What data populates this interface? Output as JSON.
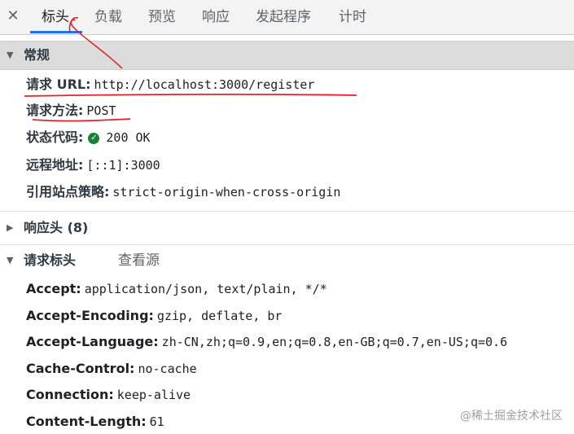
{
  "tabs": [
    "标头",
    "负载",
    "预览",
    "响应",
    "发起程序",
    "计时"
  ],
  "general": {
    "title": "常规",
    "rows": [
      {
        "key": "请求 URL:",
        "val": "http://localhost:3000/register"
      },
      {
        "key": "请求方法:",
        "val": "POST"
      },
      {
        "key": "状态代码:",
        "val": "200 OK"
      },
      {
        "key": "远程地址:",
        "val": "[::1]:3000"
      },
      {
        "key": "引用站点策略:",
        "val": "strict-origin-when-cross-origin"
      }
    ]
  },
  "response_headers": {
    "title": "响应头 (8)"
  },
  "request_headers": {
    "title": "请求标头",
    "view_source": "查看源",
    "rows": [
      {
        "key": "Accept:",
        "val": "application/json, text/plain, */*"
      },
      {
        "key": "Accept-Encoding:",
        "val": "gzip, deflate, br"
      },
      {
        "key": "Accept-Language:",
        "val": "zh-CN,zh;q=0.9,en;q=0.8,en-GB;q=0.7,en-US;q=0.6"
      },
      {
        "key": "Cache-Control:",
        "val": "no-cache"
      },
      {
        "key": "Connection:",
        "val": "keep-alive"
      },
      {
        "key": "Content-Length:",
        "val": "61"
      }
    ]
  },
  "watermark": "@稀土掘金技术社区",
  "colors": {
    "active_tab_underline": "#1a73e8",
    "status_ok": "#188038",
    "annotation": "#e0242b"
  }
}
